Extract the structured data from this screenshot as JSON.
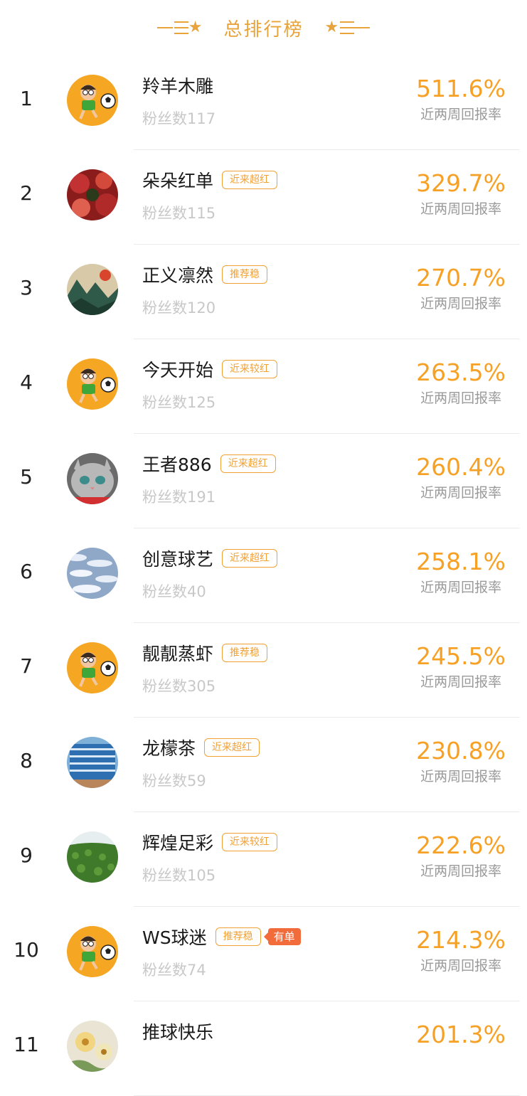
{
  "header": {
    "title": "总排行榜"
  },
  "colors": {
    "accent": "#F6A126",
    "tag_border": "#F0A136",
    "badge_bg": "#F26B3A"
  },
  "entries": [
    {
      "rank": "1",
      "name": "羚羊木雕",
      "tag": "",
      "badge": "",
      "fans": "粉丝数117",
      "rate": "511.6%",
      "rate_label": "近两周回报率",
      "avatar": "soccer-kid"
    },
    {
      "rank": "2",
      "name": "朵朵红单",
      "tag": "近来超红",
      "badge": "",
      "fans": "粉丝数115",
      "rate": "329.7%",
      "rate_label": "近两周回报率",
      "avatar": "red-leaves"
    },
    {
      "rank": "3",
      "name": "正义凛然",
      "tag": "推荐稳",
      "badge": "",
      "fans": "粉丝数120",
      "rate": "270.7%",
      "rate_label": "近两周回报率",
      "avatar": "landscape"
    },
    {
      "rank": "4",
      "name": "今天开始",
      "tag": "近来较红",
      "badge": "",
      "fans": "粉丝数125",
      "rate": "263.5%",
      "rate_label": "近两周回报率",
      "avatar": "soccer-kid"
    },
    {
      "rank": "5",
      "name": "王者886",
      "tag": "近来超红",
      "badge": "",
      "fans": "粉丝数191",
      "rate": "260.4%",
      "rate_label": "近两周回报率",
      "avatar": "cat"
    },
    {
      "rank": "6",
      "name": "创意球艺",
      "tag": "近来超红",
      "badge": "",
      "fans": "粉丝数40",
      "rate": "258.1%",
      "rate_label": "近两周回报率",
      "avatar": "clouds"
    },
    {
      "rank": "7",
      "name": "靓靓蒸虾",
      "tag": "推荐稳",
      "badge": "",
      "fans": "粉丝数305",
      "rate": "245.5%",
      "rate_label": "近两周回报率",
      "avatar": "soccer-kid"
    },
    {
      "rank": "8",
      "name": "龙檬茶",
      "tag": "近来超红",
      "badge": "",
      "fans": "粉丝数59",
      "rate": "230.8%",
      "rate_label": "近两周回报率",
      "avatar": "building"
    },
    {
      "rank": "9",
      "name": "辉煌足彩",
      "tag": "近来较红",
      "badge": "",
      "fans": "粉丝数105",
      "rate": "222.6%",
      "rate_label": "近两周回报率",
      "avatar": "field"
    },
    {
      "rank": "10",
      "name": "WS球迷",
      "tag": "推荐稳",
      "badge": "有单",
      "fans": "粉丝数74",
      "rate": "214.3%",
      "rate_label": "近两周回报率",
      "avatar": "soccer-kid"
    },
    {
      "rank": "11",
      "name": "推球快乐",
      "tag": "",
      "badge": "",
      "fans": "",
      "rate": "201.3%",
      "rate_label": "",
      "avatar": "flowers"
    }
  ]
}
